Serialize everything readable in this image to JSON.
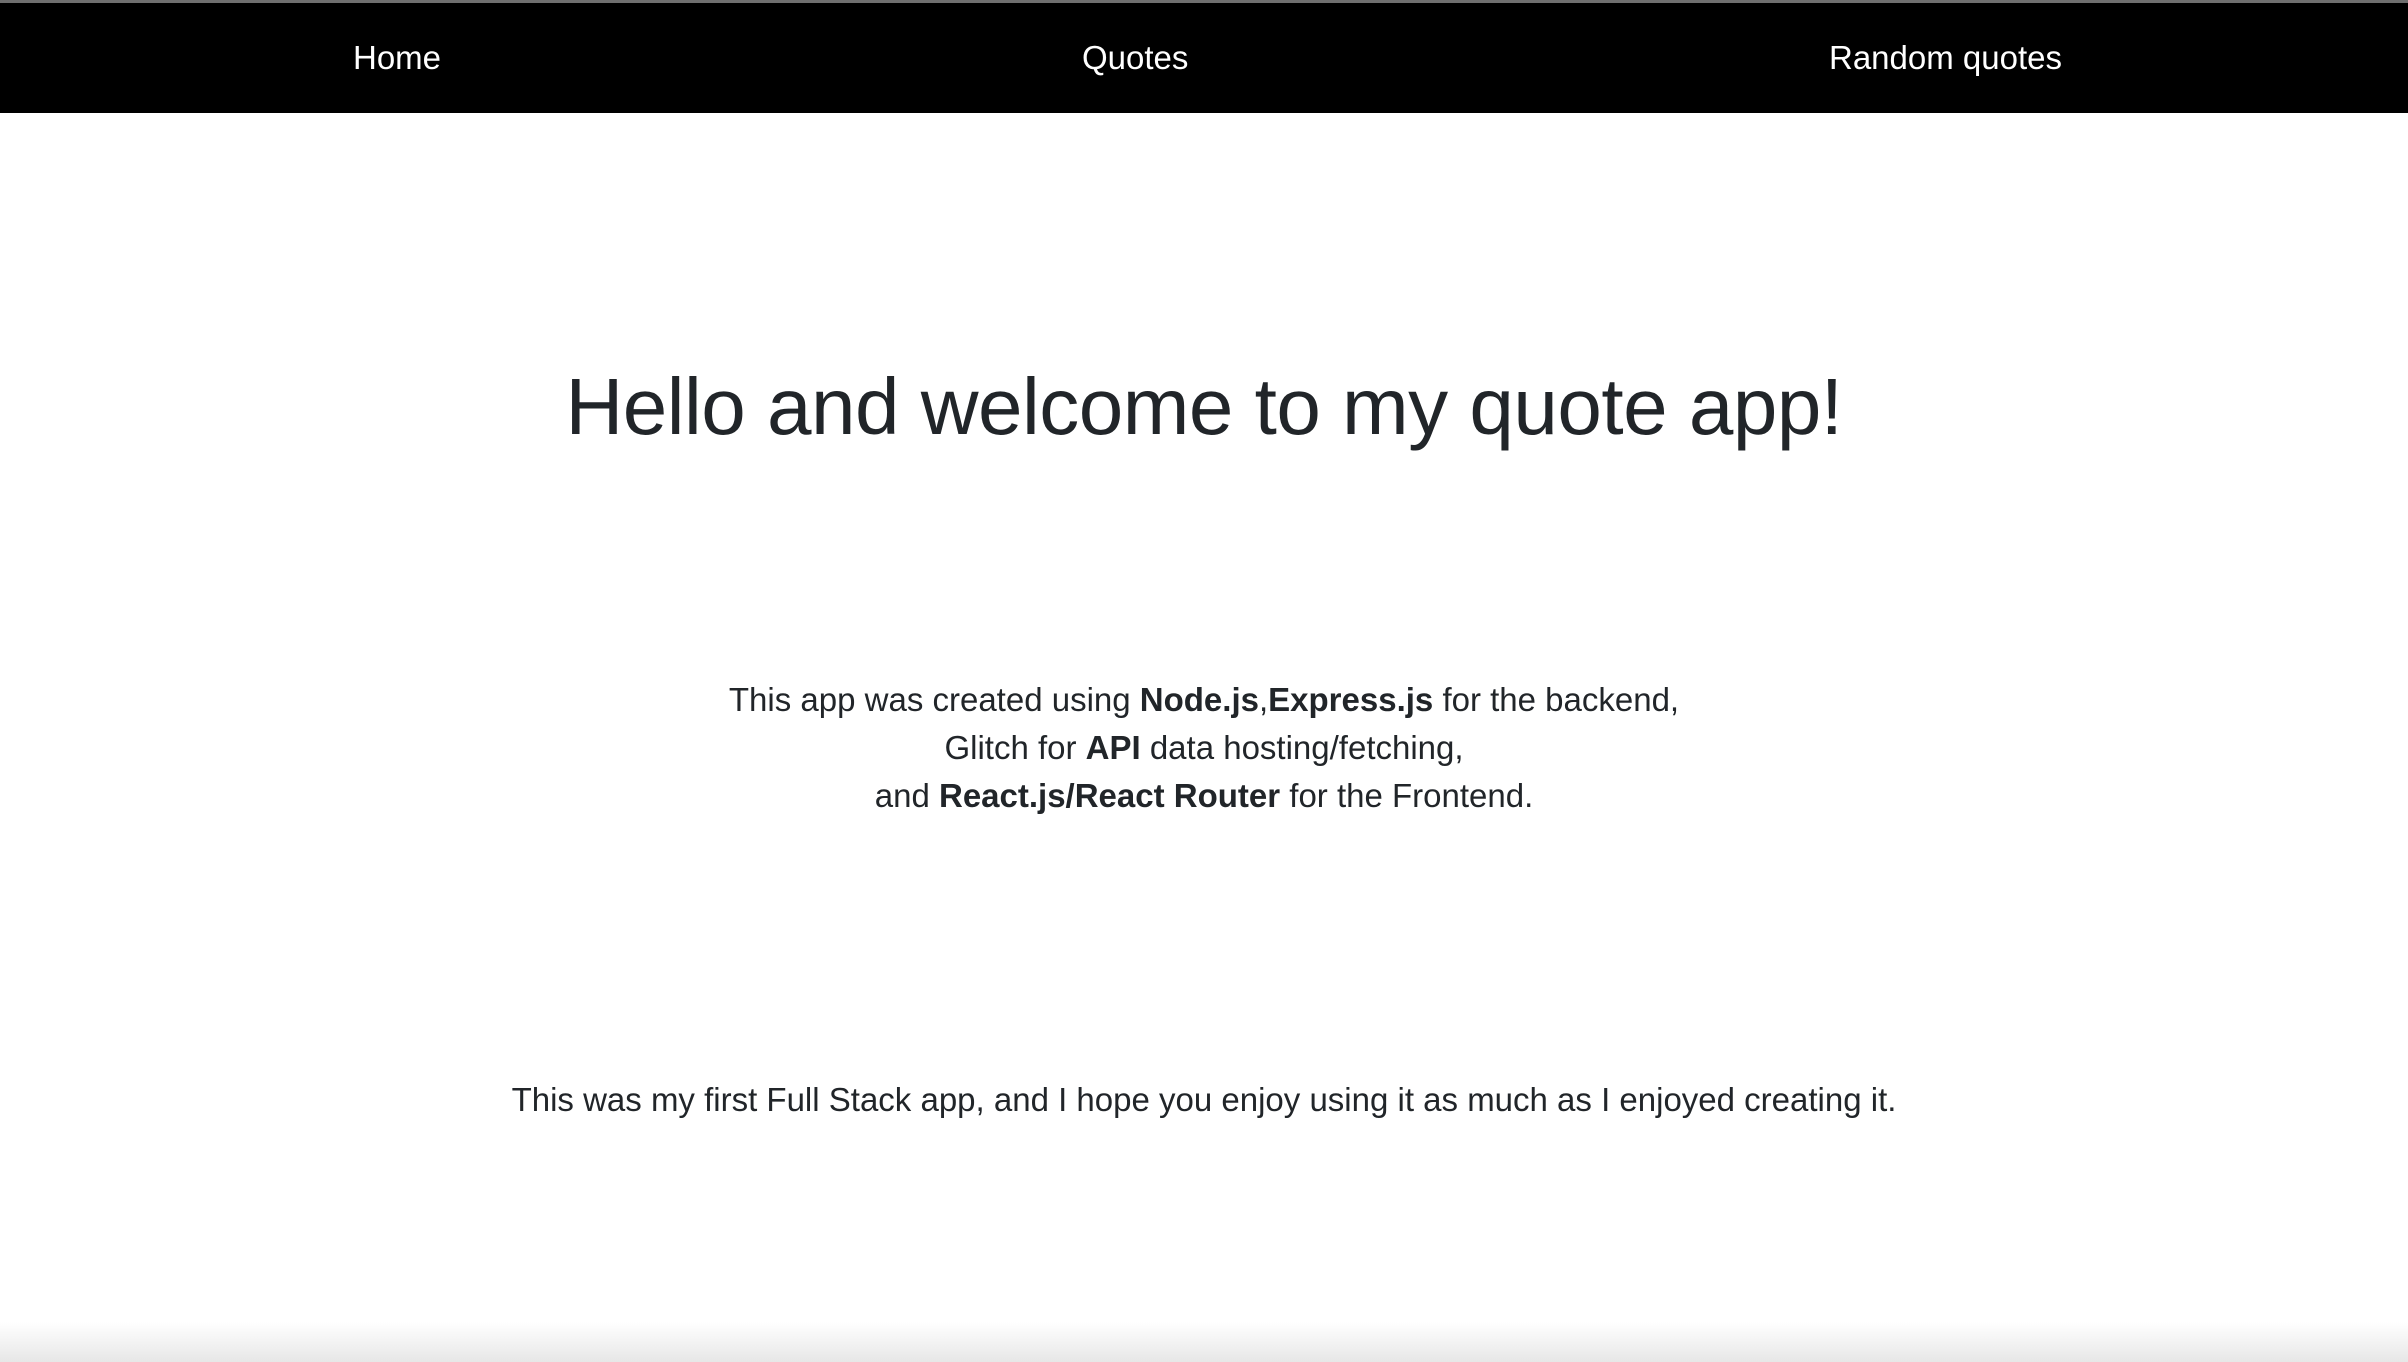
{
  "nav": {
    "home": "Home",
    "quotes": "Quotes",
    "random_quotes": "Random quotes"
  },
  "main": {
    "title": "Hello and welcome to my quote app!",
    "info": {
      "line1_pre": "This app was created using ",
      "line1_bold1": "Node.js",
      "line1_sep": ",",
      "line1_bold2": "Express.js",
      "line1_post": " for the backend,",
      "line2_pre": "Glitch for ",
      "line2_bold": "API",
      "line2_post": " data hosting/fetching,",
      "line3_pre": "and ",
      "line3_bold": "React.js/React Router",
      "line3_post": " for the Frontend."
    },
    "closing": "This was my first Full Stack app, and I hope you enjoy using it as much as I enjoyed creating it."
  },
  "colors": {
    "navbar_bg": "#000000",
    "nav_text": "#ffffff",
    "body_text": "#212529",
    "page_bg": "#ffffff"
  }
}
